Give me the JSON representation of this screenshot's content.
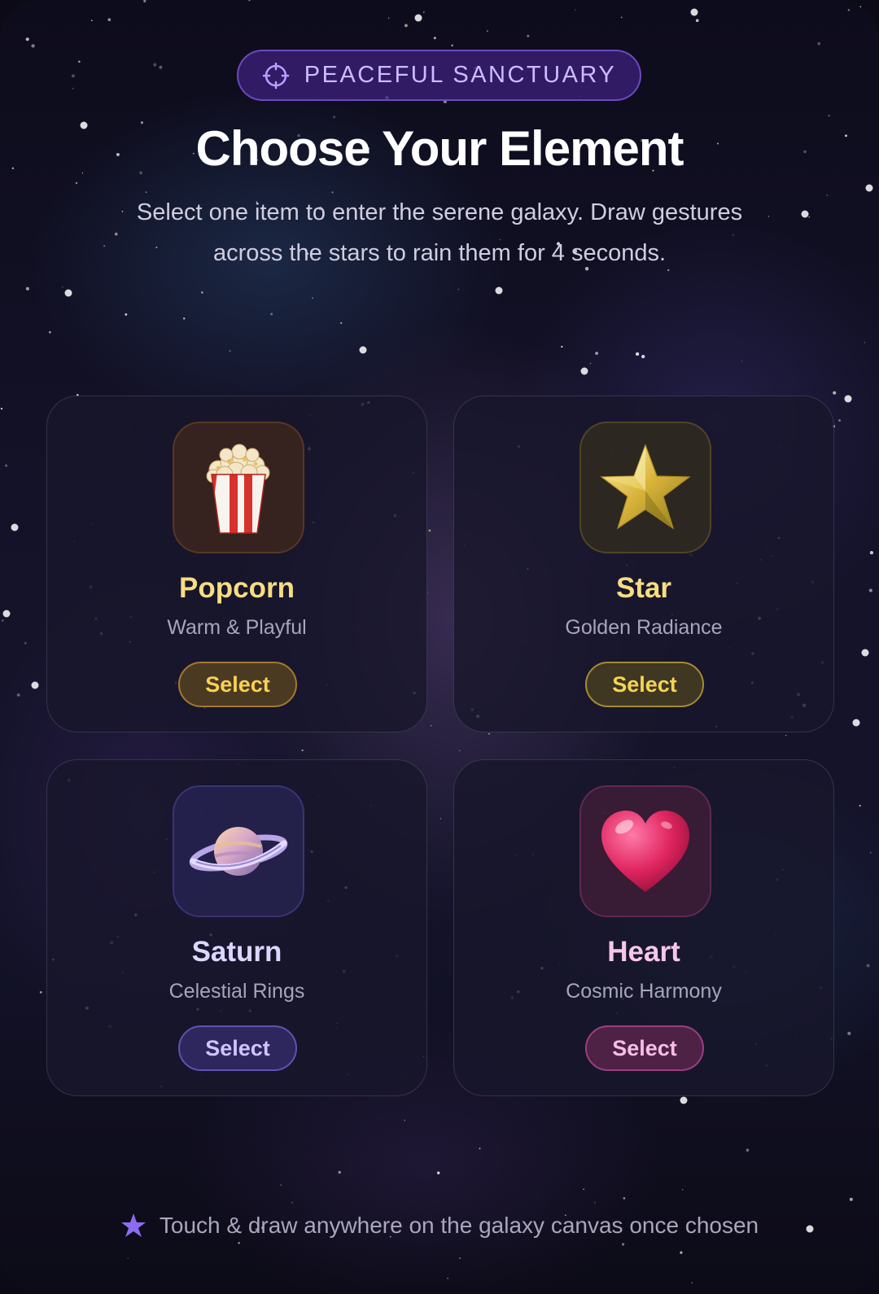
{
  "badge": {
    "icon": "crosshair-icon",
    "label": "PEACEFUL SANCTUARY"
  },
  "title": "Choose Your Element",
  "subtitle": "Select one item to enter the serene galaxy. Draw gestures across the stars to rain them for 4 seconds.",
  "cards": [
    {
      "icon": "popcorn-icon",
      "name": "Popcorn",
      "tagline": "Warm & Playful",
      "button": "Select",
      "name_color": "#f6dd82"
    },
    {
      "icon": "star-icon",
      "name": "Star",
      "tagline": "Golden Radiance",
      "button": "Select",
      "name_color": "#f6dd82"
    },
    {
      "icon": "saturn-icon",
      "name": "Saturn",
      "tagline": "Celestial Rings",
      "button": "Select",
      "name_color": "#ddd6ff"
    },
    {
      "icon": "heart-icon",
      "name": "Heart",
      "tagline": "Cosmic Harmony",
      "button": "Select",
      "name_color": "#f8c6ea"
    }
  ],
  "footer": {
    "icon": "star-icon",
    "text": "Touch & draw anywhere on the galaxy canvas once chosen"
  },
  "colors": {
    "accent": "#8b6cf0",
    "gold": "#f6d253",
    "background": "#14132a"
  }
}
